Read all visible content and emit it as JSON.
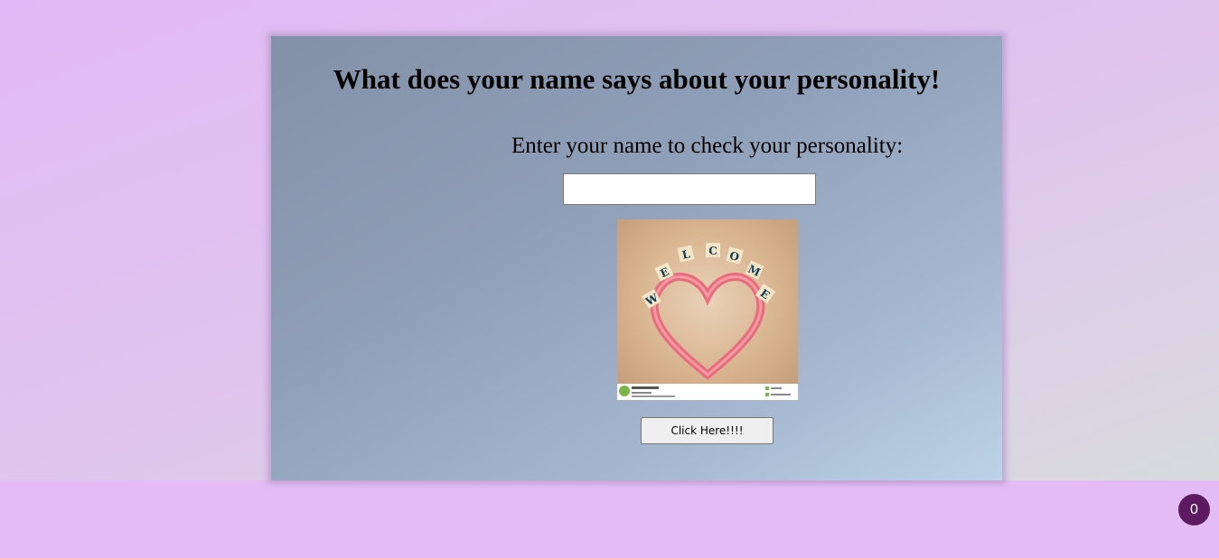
{
  "page": {
    "title": "What does your name says about your personality!",
    "prompt": "Enter your name to check your personality:",
    "name_input_value": "",
    "button_label": "Click Here!!!!",
    "image_icon": "welcome-heart-image",
    "counter_value": "0"
  },
  "colors": {
    "background": "#e3bcf5",
    "card_start": "#8391a8",
    "card_end": "#bcd3e7",
    "counter_badge": "#5e1a5f"
  }
}
